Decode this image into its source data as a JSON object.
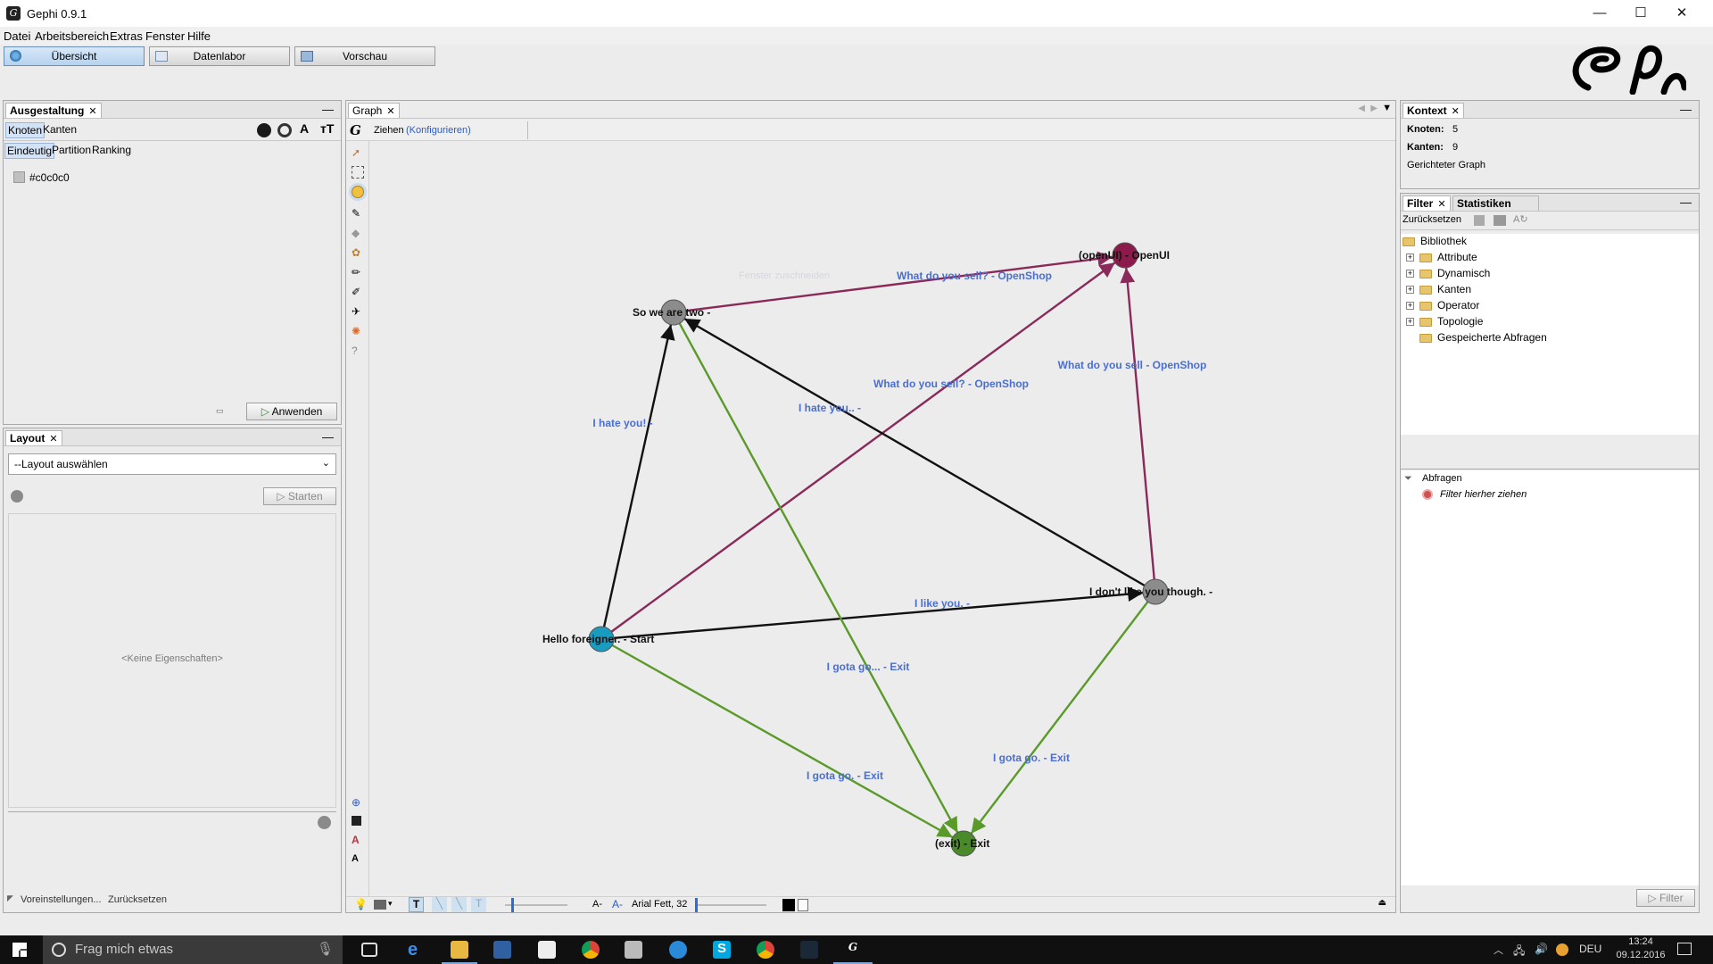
{
  "window": {
    "title": "Gephi 0.9.1",
    "minimize": "—",
    "maximize": "☐",
    "close": "✕"
  },
  "menu": [
    "Datei",
    "Arbeitsbereich",
    "Extras",
    "Fenster",
    "Hilfe"
  ],
  "perspectives": [
    {
      "label": "Übersicht",
      "active": true
    },
    {
      "label": "Datenlabor",
      "active": false
    },
    {
      "label": "Vorschau",
      "active": false
    }
  ],
  "appearance": {
    "tab": "Ausgestaltung",
    "close": "✕",
    "minimize": "—",
    "tabs": [
      "Knoten",
      "Kanten"
    ],
    "modes": [
      "Eindeutig",
      "Partition",
      "Ranking"
    ],
    "color_value": "#c0c0c0",
    "apply_label": "Anwenden"
  },
  "layout": {
    "tab": "Layout",
    "close": "✕",
    "minimize": "—",
    "select": "--Layout auswählen",
    "start_label": "Starten",
    "no_properties": "<Keine Eigenschaften>",
    "presets": "Voreinstellungen...",
    "reset": "Zurücksetzen"
  },
  "graph": {
    "tab": "Graph",
    "close": "✕",
    "tool_label": "Ziehen",
    "configure": "(Konfigurieren)",
    "faded_hint": "Fenster zuschneiden",
    "nodes": [
      {
        "id": "two",
        "label": "So we are two -",
        "color": "#8c8c8c"
      },
      {
        "id": "openui",
        "label": "(openUI) - OpenUI",
        "color": "#8c1a4a"
      },
      {
        "id": "start",
        "label": "Hello foreigner. - Start",
        "color": "#1a9bc0"
      },
      {
        "id": "dislike",
        "label": "I don't like you though. -",
        "color": "#8c8c8c"
      },
      {
        "id": "exit",
        "label": "(exit) - Exit",
        "color": "#4a8a2a"
      }
    ],
    "edges": [
      {
        "from": "two",
        "to": "openui",
        "label": "What do you sell? - OpenShop",
        "color": "#8a2a5a"
      },
      {
        "from": "start",
        "to": "openui",
        "label": "What do you sell? - OpenShop",
        "color": "#8a2a5a"
      },
      {
        "from": "dislike",
        "to": "openui",
        "label": "What do you sell - OpenShop",
        "color": "#8a2a5a"
      },
      {
        "from": "start",
        "to": "two",
        "label": "I hate you! -",
        "color": "#111111"
      },
      {
        "from": "dislike",
        "to": "two",
        "label": "I hate you.. -",
        "color": "#111111"
      },
      {
        "from": "start",
        "to": "dislike",
        "label": "I like you. -",
        "color": "#111111"
      },
      {
        "from": "two",
        "to": "exit",
        "label": "I gota go... - Exit",
        "color": "#5a9a2a"
      },
      {
        "from": "start",
        "to": "exit",
        "label": "I gota go. - Exit",
        "color": "#5a9a2a"
      },
      {
        "from": "dislike",
        "to": "exit",
        "label": "I gota go. - Exit",
        "color": "#5a9a2a"
      }
    ],
    "font_label": "Arial Fett, 32"
  },
  "context": {
    "tab": "Kontext",
    "close": "✕",
    "minimize": "—",
    "nodes_label": "Knoten:",
    "nodes_value": "5",
    "edges_label": "Kanten:",
    "edges_value": "9",
    "graph_type": "Gerichteter Graph"
  },
  "filter": {
    "tabs": [
      "Filter",
      "Statistiken"
    ],
    "close": "✕",
    "minimize": "—",
    "reset": "Zurücksetzen",
    "library": "Bibliothek",
    "items": [
      "Attribute",
      "Dynamisch",
      "Kanten",
      "Operator",
      "Topologie",
      "Gespeicherte Abfragen"
    ],
    "queries": "Abfragen",
    "drop_hint": "Filter hierher ziehen",
    "filter_button": "Filter"
  },
  "taskbar": {
    "search_placeholder": "Frag mich etwas",
    "language": "DEU",
    "time": "13:24",
    "date": "09.12.2016"
  }
}
